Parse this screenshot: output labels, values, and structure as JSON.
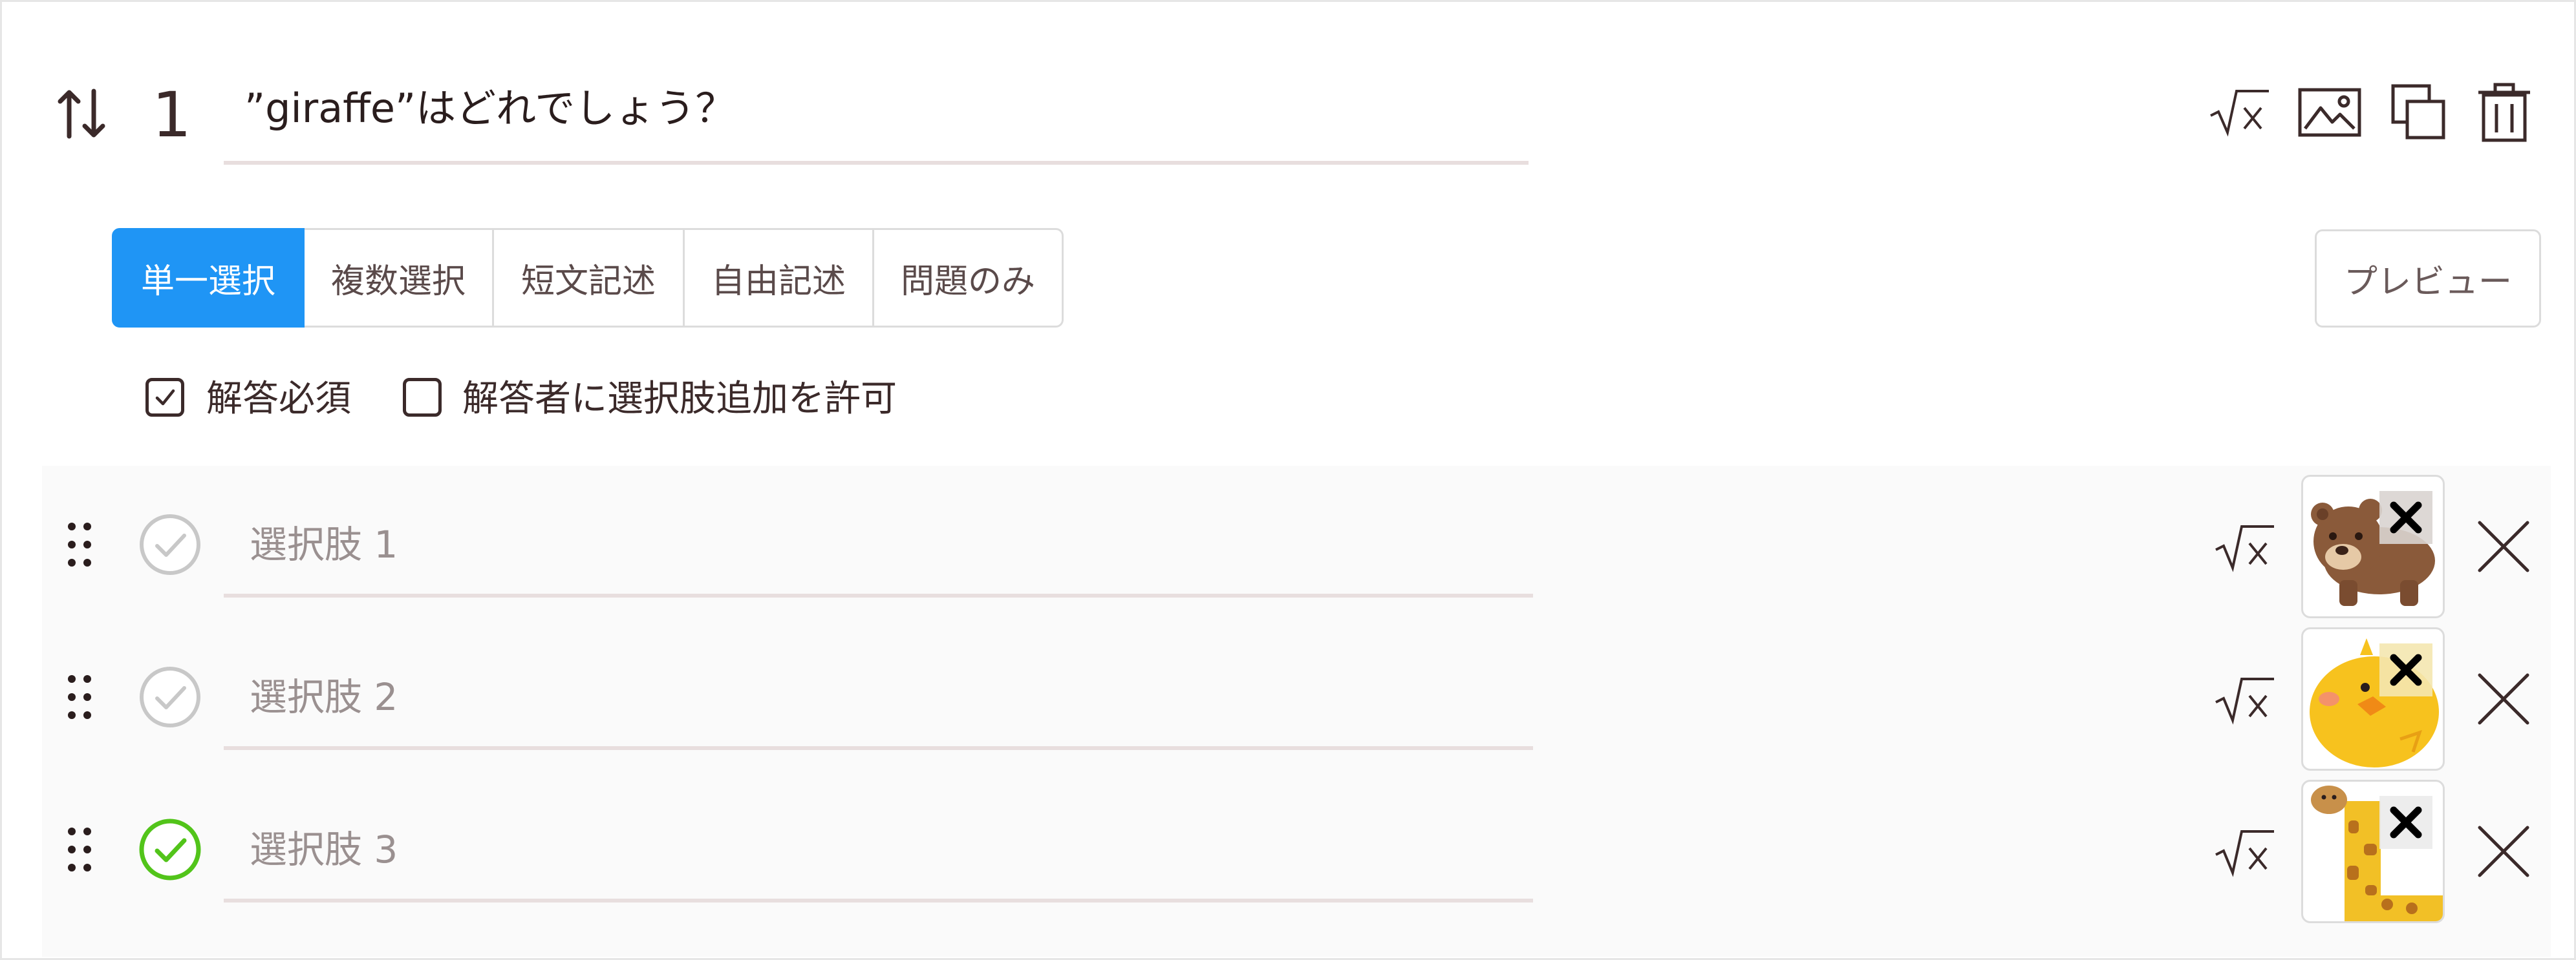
{
  "question": {
    "number": "1",
    "title": "”giraffe”はどれでしょう？"
  },
  "tabs": [
    {
      "label": "単一選択",
      "active": true
    },
    {
      "label": "複数選択",
      "active": false
    },
    {
      "label": "短文記述",
      "active": false
    },
    {
      "label": "自由記述",
      "active": false
    },
    {
      "label": "問題のみ",
      "active": false
    }
  ],
  "preview_label": "プレビュー",
  "options": {
    "required_label": "解答必須",
    "required_checked": true,
    "allow_add_label": "解答者に選択肢追加を許可",
    "allow_add_checked": false
  },
  "choices": [
    {
      "placeholder": "選択肢 1",
      "correct": false,
      "image": "bear-image"
    },
    {
      "placeholder": "選択肢 2",
      "correct": false,
      "image": "chick-image"
    },
    {
      "placeholder": "選択肢 3",
      "correct": true,
      "image": "giraffe-image"
    }
  ],
  "icons": {
    "sort": "sort-arrows-icon",
    "formula": "square-root-icon",
    "image": "image-icon",
    "copy": "copy-icon",
    "delete": "trash-icon",
    "drag": "drag-handle-icon",
    "check": "check-circle-icon",
    "remove": "close-icon"
  },
  "colors": {
    "accent": "#1f95f5",
    "correct": "#52c41a",
    "inactive_check": "#c8c8c8",
    "text": "#3b2a2a"
  }
}
